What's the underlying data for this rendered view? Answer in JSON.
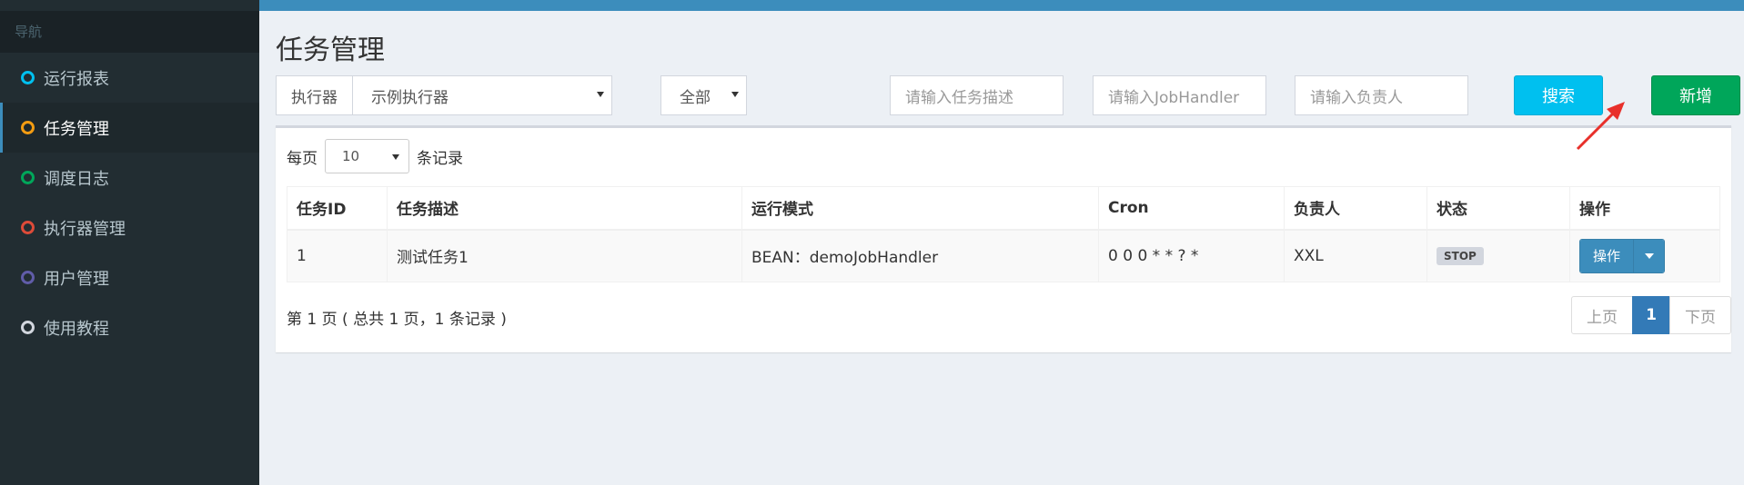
{
  "sidebar": {
    "header": "导航",
    "items": [
      {
        "label": "运行报表",
        "color": "#00c0ef"
      },
      {
        "label": "任务管理",
        "color": "#f39c12",
        "active": true
      },
      {
        "label": "调度日志",
        "color": "#00a65a"
      },
      {
        "label": "执行器管理",
        "color": "#dd4b39"
      },
      {
        "label": "用户管理",
        "color": "#605ca8"
      },
      {
        "label": "使用教程",
        "color": "#d2d6de"
      }
    ]
  },
  "page": {
    "title": "任务管理"
  },
  "filters": {
    "executor_label": "执行器",
    "executor_value": "示例执行器",
    "status_value": "全部",
    "job_desc_placeholder": "请输入任务描述",
    "job_handler_placeholder": "请输入JobHandler",
    "author_placeholder": "请输入负责人",
    "search_label": "搜索",
    "add_label": "新增"
  },
  "table": {
    "pagesize_prefix": "每页",
    "pagesize_value": "10",
    "pagesize_suffix": "条记录",
    "headers": [
      "任务ID",
      "任务描述",
      "运行模式",
      "Cron",
      "负责人",
      "状态",
      "操作"
    ],
    "rows": [
      {
        "id": "1",
        "desc": "测试任务1",
        "mode": "BEAN：demoJobHandler",
        "cron": "0 0 0 * * ? *",
        "author": "XXL",
        "status": "STOP",
        "action": "操作"
      }
    ]
  },
  "pagination": {
    "info": "第 1 页 ( 总共 1 页，1 条记录 )",
    "prev": "上页",
    "current": "1",
    "next": "下页"
  }
}
